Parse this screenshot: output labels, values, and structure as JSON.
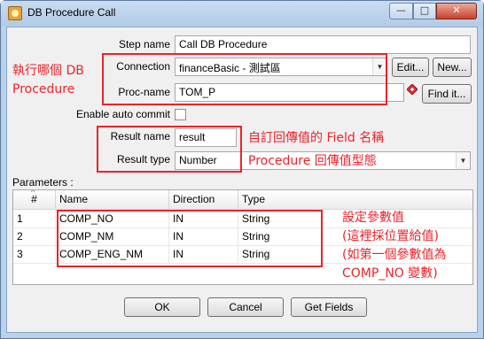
{
  "window": {
    "title": "DB Procedure Call",
    "minimize": "—",
    "maximize": "□",
    "close": "✕"
  },
  "form": {
    "step_name_label": "Step name",
    "step_name_value": "Call DB Procedure",
    "connection_label": "Connection",
    "connection_value": "financeBasic - 測試區",
    "edit_button": "Edit...",
    "new_button": "New...",
    "proc_name_label": "Proc-name",
    "proc_name_value": "TOM_P",
    "find_button": "Find it...",
    "auto_commit_label": "Enable auto commit",
    "result_name_label": "Result name",
    "result_name_value": "result",
    "result_type_label": "Result type",
    "result_type_value": "Number"
  },
  "parameters": {
    "label": "Parameters :",
    "sort_glyph": "^",
    "columns": [
      "#",
      "Name",
      "Direction",
      "Type"
    ],
    "rows": [
      [
        "1",
        "COMP_NO",
        "IN",
        "String"
      ],
      [
        "2",
        "COMP_NM",
        "IN",
        "String"
      ],
      [
        "3",
        "COMP_ENG_NM",
        "IN",
        "String"
      ]
    ]
  },
  "buttons": {
    "ok": "OK",
    "cancel": "Cancel",
    "get_fields": "Get Fields"
  },
  "annotations": {
    "db_procedure_line1": "執行哪個 DB",
    "db_procedure_line2": "Procedure",
    "return_field_name": "自訂回傳值的 Field 名稱",
    "return_type": "Procedure 回傳值型態",
    "params_line1": "設定參數值",
    "params_line2": "(這裡採位置給值)",
    "params_line3": "(如第一個參數值為",
    "params_line4": "COMP_NO 變數)"
  },
  "colors": {
    "annotation_red": "#e8242c",
    "window_frame": "#b9d1ea",
    "client_bg": "#f0f0f0"
  },
  "icons": {
    "app": "procedure-call-icon",
    "variable": "variable-diamond-icon",
    "dropdown": "chevron-down-icon"
  }
}
